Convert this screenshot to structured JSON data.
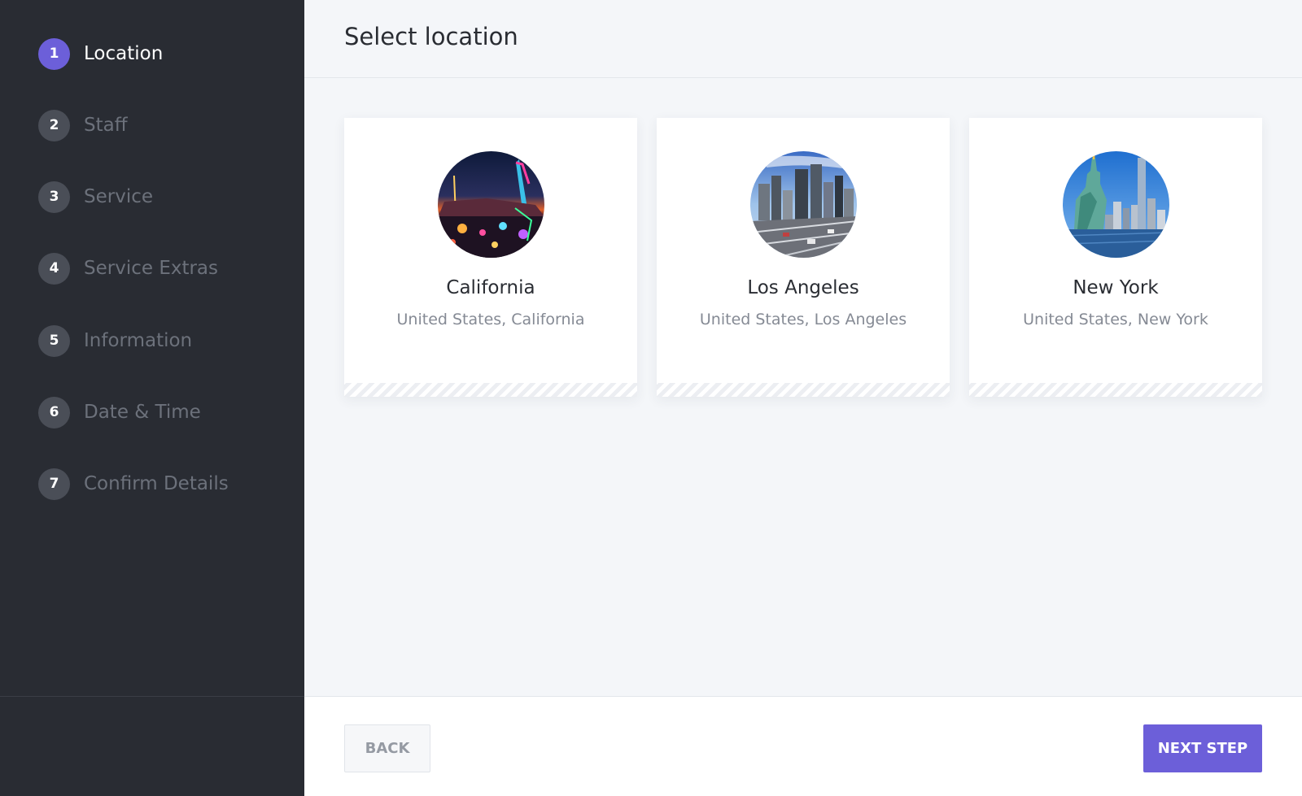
{
  "sidebar": {
    "steps": [
      {
        "number": "1",
        "label": "Location",
        "active": true
      },
      {
        "number": "2",
        "label": "Staff",
        "active": false
      },
      {
        "number": "3",
        "label": "Service",
        "active": false
      },
      {
        "number": "4",
        "label": "Service Extras",
        "active": false
      },
      {
        "number": "5",
        "label": "Information",
        "active": false
      },
      {
        "number": "6",
        "label": "Date & Time",
        "active": false
      },
      {
        "number": "7",
        "label": "Confirm Details",
        "active": false
      }
    ]
  },
  "header": {
    "title": "Select location"
  },
  "locations": [
    {
      "name": "California",
      "subtitle": "United States, California",
      "image": "california-carnival-photo"
    },
    {
      "name": "Los Angeles",
      "subtitle": "United States, Los Angeles",
      "image": "los-angeles-skyline-photo"
    },
    {
      "name": "New York",
      "subtitle": "United States, New York",
      "image": "new-york-statue-of-liberty-photo"
    }
  ],
  "footer": {
    "back_label": "BACK",
    "next_label": "NEXT STEP"
  },
  "colors": {
    "accent": "#6c5fd9",
    "sidebar_bg": "#292c33",
    "main_bg": "#f4f6f9"
  }
}
